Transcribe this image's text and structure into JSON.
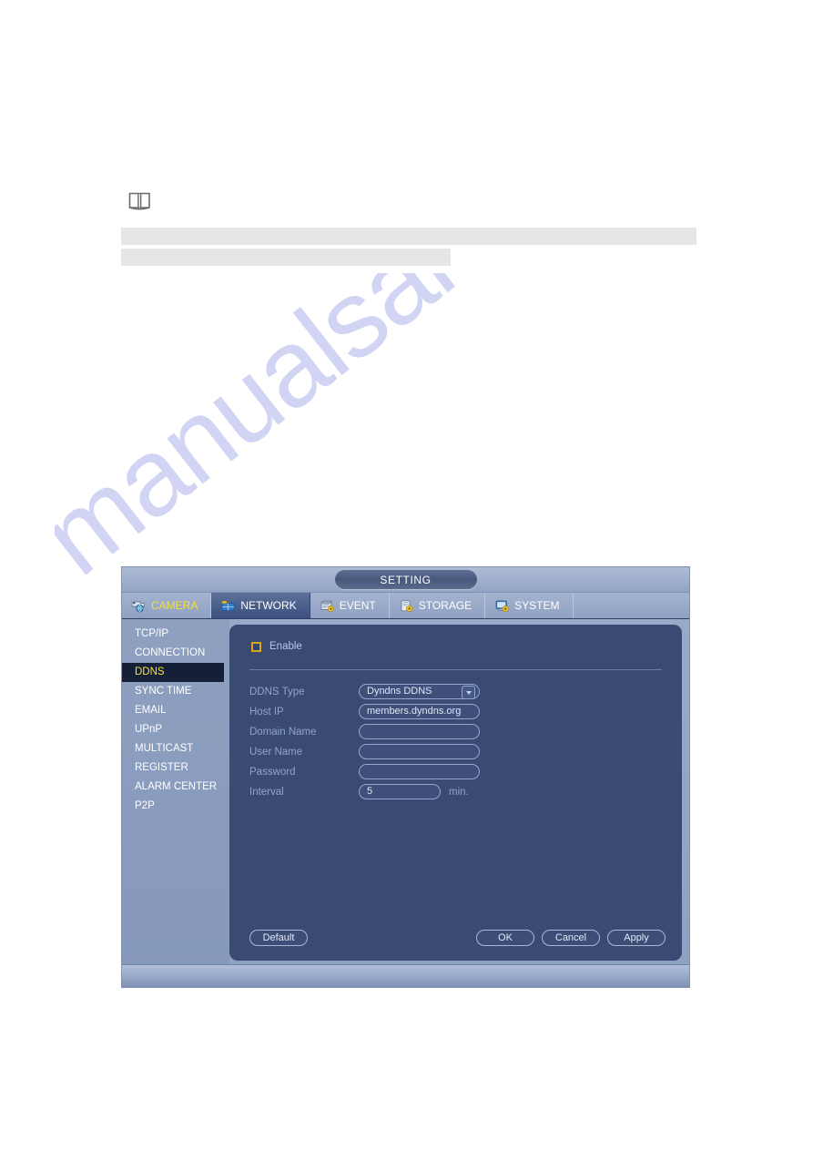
{
  "document": {
    "note_icon": "open-book-icon",
    "redacted_lines": [
      "",
      ""
    ],
    "watermark": "manualsarchive.com"
  },
  "dialog": {
    "title": "SETTING",
    "tabs": [
      {
        "label": "CAMERA",
        "icon": "camera-globe-icon",
        "state": "hover"
      },
      {
        "label": "NETWORK",
        "icon": "network-icon",
        "state": "active"
      },
      {
        "label": "EVENT",
        "icon": "event-gear-icon",
        "state": "normal"
      },
      {
        "label": "STORAGE",
        "icon": "storage-gear-icon",
        "state": "normal"
      },
      {
        "label": "SYSTEM",
        "icon": "system-gear-icon",
        "state": "normal"
      }
    ],
    "sidebar": {
      "items": [
        {
          "label": "TCP/IP",
          "selected": false
        },
        {
          "label": "CONNECTION",
          "selected": false
        },
        {
          "label": "DDNS",
          "selected": true
        },
        {
          "label": "SYNC TIME",
          "selected": false
        },
        {
          "label": "EMAIL",
          "selected": false
        },
        {
          "label": "UPnP",
          "selected": false
        },
        {
          "label": "MULTICAST",
          "selected": false
        },
        {
          "label": "REGISTER",
          "selected": false
        },
        {
          "label": "ALARM CENTER",
          "selected": false
        },
        {
          "label": "P2P",
          "selected": false
        }
      ]
    },
    "panel": {
      "enable": {
        "label": "Enable",
        "checked": false
      },
      "fields": [
        {
          "label": "DDNS Type",
          "value": "Dyndns DDNS",
          "type": "select",
          "unit": ""
        },
        {
          "label": "Host IP",
          "value": "members.dyndns.org",
          "type": "text",
          "unit": ""
        },
        {
          "label": "Domain Name",
          "value": "",
          "type": "text",
          "unit": ""
        },
        {
          "label": "User Name",
          "value": "",
          "type": "text",
          "unit": ""
        },
        {
          "label": "Password",
          "value": "",
          "type": "password",
          "unit": ""
        },
        {
          "label": "Interval",
          "value": "5",
          "type": "number",
          "unit": "min."
        }
      ]
    },
    "buttons": {
      "default": "Default",
      "ok": "OK",
      "cancel": "Cancel",
      "apply": "Apply"
    }
  },
  "colors": {
    "accent_yellow": "#f5e03a",
    "panel_bg": "#3a4b73",
    "window_bg": "#93a4c4",
    "selected_row": "#161f38",
    "checkbox_border": "#d3a825",
    "watermark": "#c9cdf0"
  }
}
